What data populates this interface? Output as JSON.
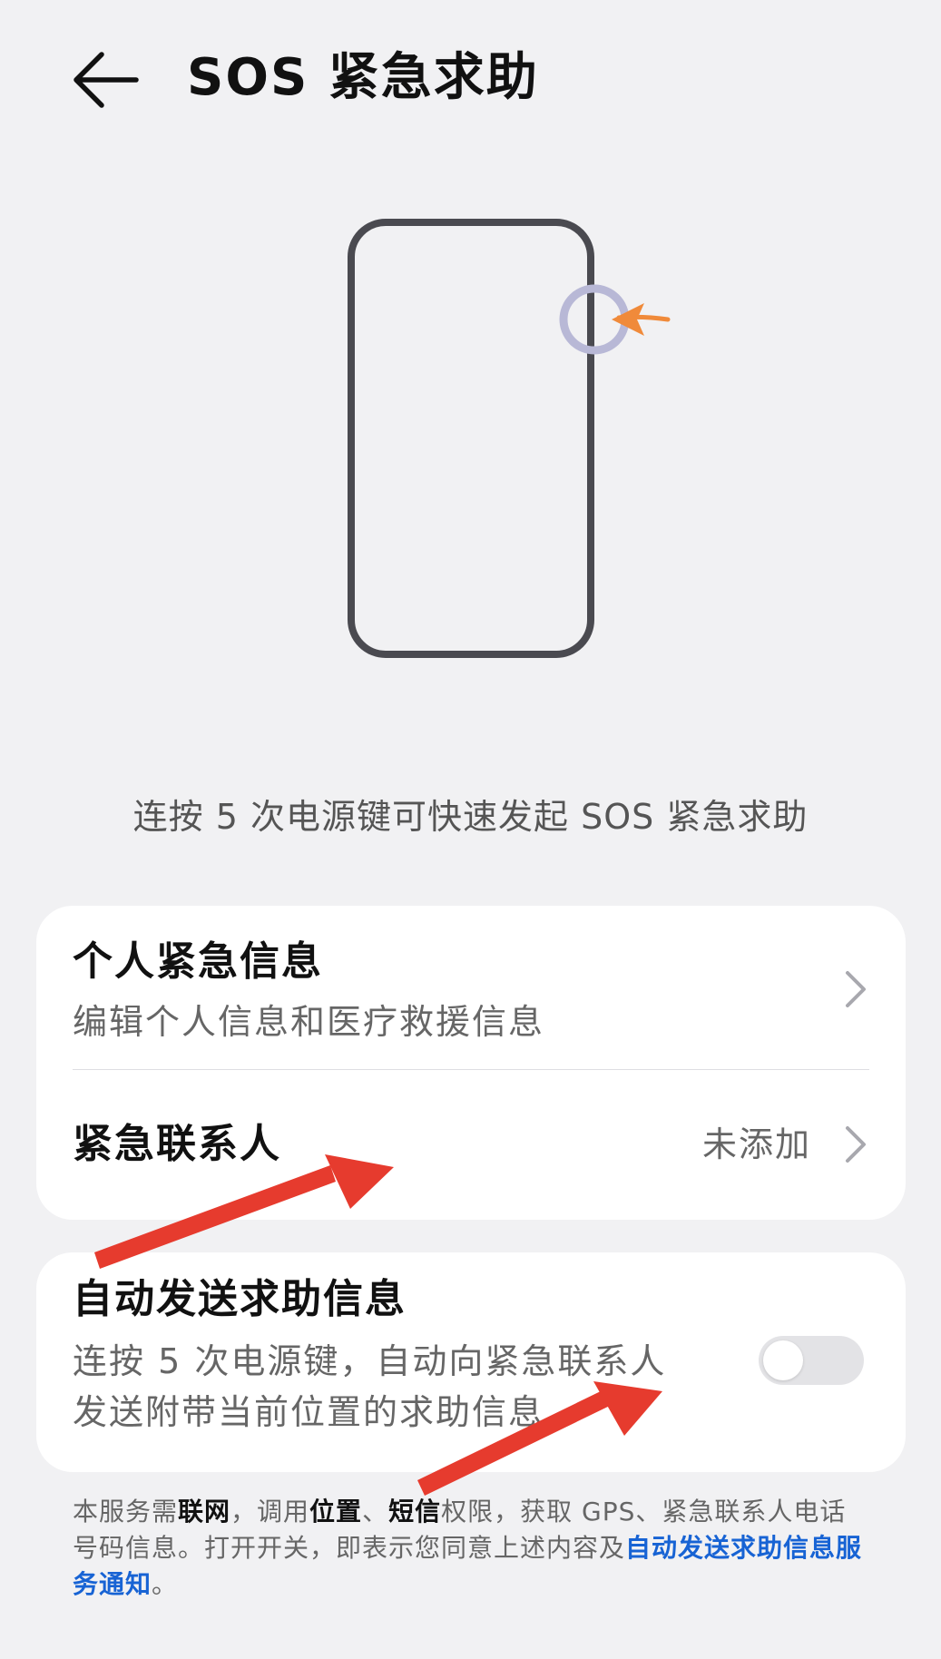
{
  "header": {
    "title": "SOS 紧急求助"
  },
  "caption": "连按 5 次电源键可快速发起 SOS 紧急求助",
  "personal_info": {
    "title": "个人紧急信息",
    "subtitle": "编辑个人信息和医疗救援信息"
  },
  "emergency_contact": {
    "title": "紧急联系人",
    "value": "未添加"
  },
  "auto_send": {
    "title": "自动发送求助信息",
    "description": "连按 5 次电源键，自动向紧急联系人发送附带当前位置的求助信息",
    "enabled": false
  },
  "footnote": {
    "p1": "本服务需",
    "b1": "联网",
    "p2": "，调用",
    "b2": "位置",
    "p3": "、",
    "b3": "短信",
    "p4": "权限，获取 GPS、紧急联系人电话号码信息。打开开关，即表示您同意上述内容及",
    "link": "自动发送求助信息服务通知",
    "p5": "。"
  },
  "colors": {
    "background": "#f1f1f3",
    "card": "#ffffff",
    "link": "#1763d4",
    "annotation_arrow": "#e63b2e",
    "power_indicator_arrow": "#f08a3a",
    "phone_outline": "#4a4a50",
    "power_ring": "#b8b8d6",
    "toggle_off": "#e3e3e6"
  },
  "icons": {
    "back": "arrow-left-icon",
    "chevron": "chevron-right-icon",
    "phone": "phone-outline-icon"
  }
}
